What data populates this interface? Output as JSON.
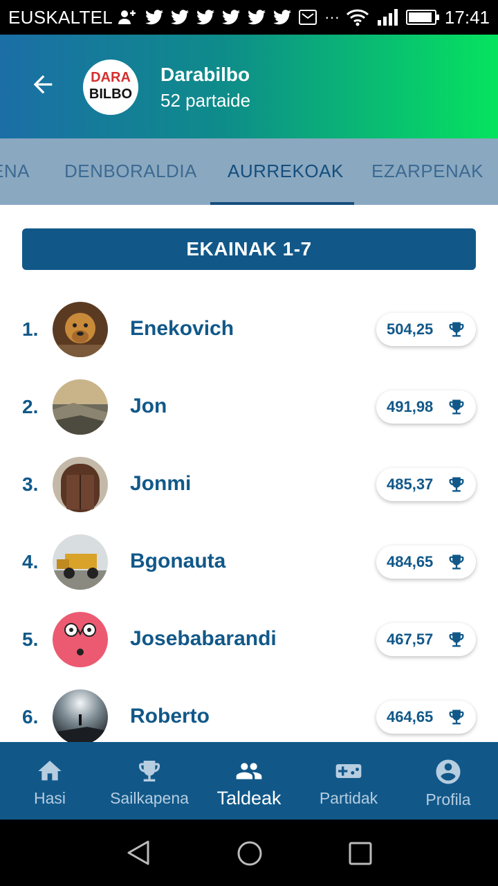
{
  "status_bar": {
    "carrier": "EUSKALTEL",
    "time": "17:41",
    "icons": [
      "add-user-icon",
      "twitter-icon",
      "twitter-icon",
      "twitter-icon",
      "twitter-icon",
      "twitter-icon",
      "twitter-icon",
      "mail-icon",
      "more-icon",
      "wifi-icon",
      "signal-icon",
      "battery-icon"
    ],
    "battery_level": 0.92
  },
  "header": {
    "title": "Darabilbo",
    "subtitle": "52 partaide",
    "logo_text_top": "DARA",
    "logo_text_bottom": "BILBO"
  },
  "tabs": [
    {
      "label": "ENA",
      "active": false
    },
    {
      "label": "DENBORALDIA",
      "active": false
    },
    {
      "label": "AURREKOAK",
      "active": true
    },
    {
      "label": "EZARPENAK",
      "active": false
    }
  ],
  "week_label": "EKAINAK 1-7",
  "ranking": [
    {
      "position": "1.",
      "name": "Enekovich",
      "score": "504,25"
    },
    {
      "position": "2.",
      "name": "Jon",
      "score": "491,98"
    },
    {
      "position": "3.",
      "name": "Jonmi",
      "score": "485,37"
    },
    {
      "position": "4.",
      "name": "Bgonauta",
      "score": "484,65"
    },
    {
      "position": "5.",
      "name": "Josebabarandi",
      "score": "467,57"
    },
    {
      "position": "6.",
      "name": "Roberto",
      "score": "464,65"
    }
  ],
  "bottom_nav": [
    {
      "label": "Hasi",
      "icon": "home-icon",
      "active": false
    },
    {
      "label": "Sailkapena",
      "icon": "trophy-icon",
      "active": false
    },
    {
      "label": "Taldeak",
      "icon": "group-icon",
      "active": true
    },
    {
      "label": "Partidak",
      "icon": "gamepad-icon",
      "active": false
    },
    {
      "label": "Profila",
      "icon": "account-icon",
      "active": false
    }
  ],
  "colors": {
    "primary": "#115889",
    "tab_bg": "#8aa8c0",
    "gradient_start": "#1b6ea6",
    "gradient_end": "#05e35f"
  }
}
